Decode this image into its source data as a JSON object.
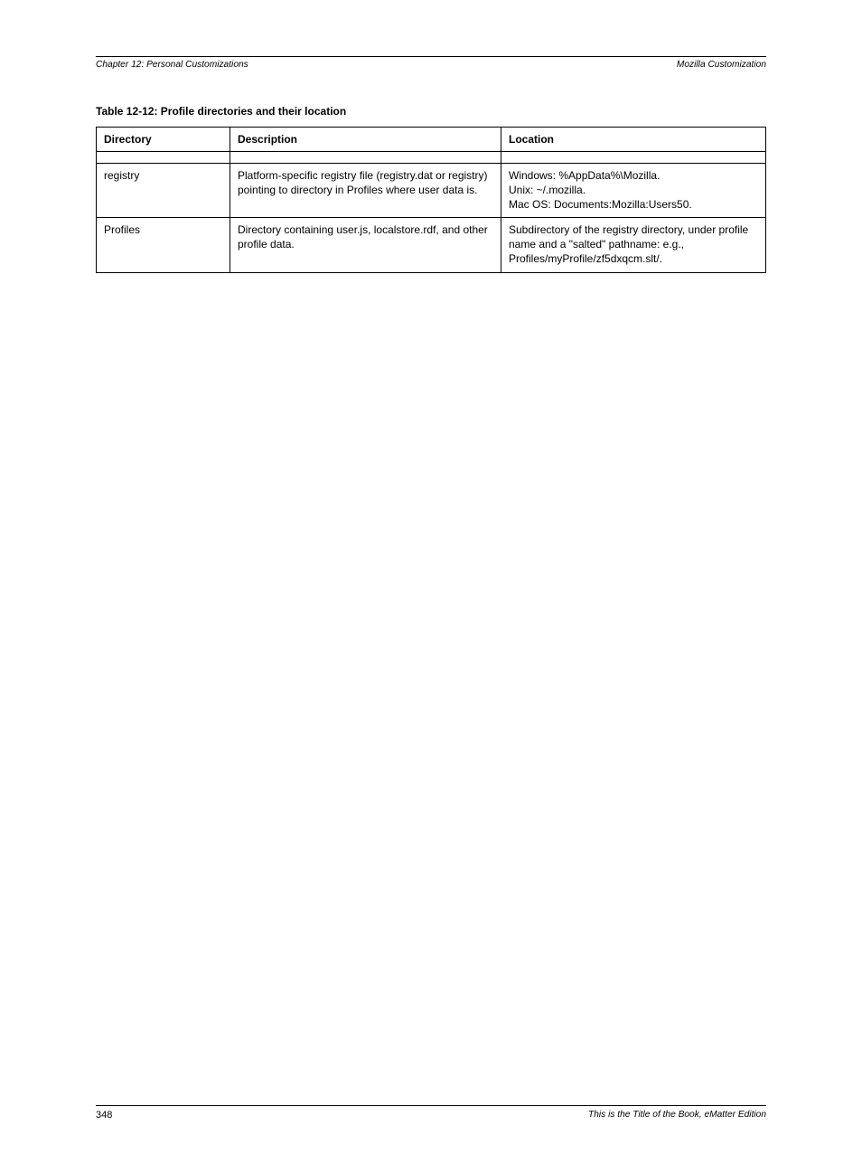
{
  "header": {
    "left": "Chapter 12: Personal Customizations",
    "right": "Mozilla Customization"
  },
  "table": {
    "caption": "Table 12-12: Profile directories and their location",
    "columns": [
      "Directory",
      "Description",
      "Location"
    ],
    "rows": [
      {
        "directory": "registry",
        "description": "Platform-specific registry file (registry.dat or registry) pointing to directory in Profiles where user data is.",
        "location": "Windows: %AppData%\\Mozilla.\nUnix: ~/.mozilla.\nMac OS: Documents:Mozilla:Users50."
      },
      {
        "directory": "Profiles",
        "description": "Directory containing user.js, localstore.rdf, and other profile data.",
        "location": "Subdirectory of the registry directory, under profile name and a \"salted\" pathname: e.g., Profiles/myProfile/zf5dxqcm.slt/."
      }
    ]
  },
  "footer": {
    "left": "This is the Title of the Book, eMatter Edition",
    "page": "348"
  }
}
